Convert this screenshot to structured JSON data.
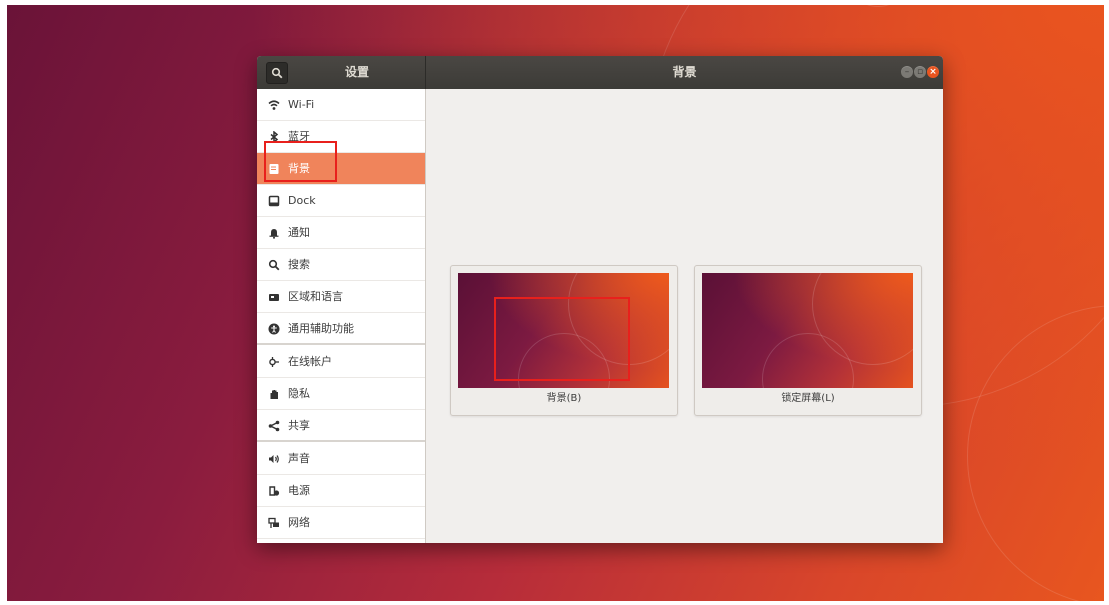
{
  "window": {
    "sidebar_title": "设置",
    "page_title": "背景"
  },
  "sidebar": {
    "items": [
      {
        "label": "Wi-Fi",
        "icon": "wifi-icon"
      },
      {
        "label": "蓝牙",
        "icon": "bluetooth-icon"
      },
      {
        "label": "背景",
        "icon": "background-icon",
        "selected": true
      },
      {
        "label": "Dock",
        "icon": "dock-icon"
      },
      {
        "label": "通知",
        "icon": "bell-icon"
      },
      {
        "label": "搜索",
        "icon": "search-icon"
      },
      {
        "label": "区域和语言",
        "icon": "flag-icon"
      },
      {
        "label": "通用辅助功能",
        "icon": "accessibility-icon"
      },
      {
        "label": "在线帐户",
        "icon": "online-accounts-icon"
      },
      {
        "label": "隐私",
        "icon": "hand-icon"
      },
      {
        "label": "共享",
        "icon": "share-icon"
      },
      {
        "label": "声音",
        "icon": "speaker-icon"
      },
      {
        "label": "电源",
        "icon": "power-icon"
      },
      {
        "label": "网络",
        "icon": "network-icon"
      }
    ]
  },
  "cards": {
    "background_label": "背景(B)",
    "lock_screen_label": "锁定屏幕(L)"
  },
  "colors": {
    "selection": "#f0845b",
    "accent": "#e9541f",
    "annotation": "#e8201c",
    "titlebar": "#3c3b37"
  }
}
